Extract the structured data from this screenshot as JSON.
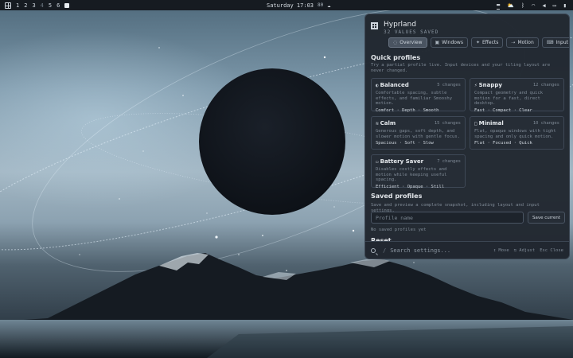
{
  "topbar": {
    "workspaces": [
      "1",
      "2",
      "3",
      "4",
      "5",
      "6"
    ],
    "clock": "Saturday 17:03",
    "clock_extra": "80",
    "tray_icons": [
      "screen-icon",
      "cloud-upload-icon",
      "bluetooth-icon",
      "wifi-icon",
      "volume-icon",
      "monitor-icon",
      "battery-icon"
    ]
  },
  "panel": {
    "title": "Hyprland",
    "subtitle": "32 VALUES SAVED",
    "tabs": [
      {
        "icon": "◌",
        "label": "Overview"
      },
      {
        "icon": "▣",
        "label": "Windows"
      },
      {
        "icon": "✦",
        "label": "Effects"
      },
      {
        "icon": "⇢",
        "label": "Motion"
      },
      {
        "icon": "⌨",
        "label": "Input"
      }
    ],
    "quick_profiles": {
      "title": "Quick profiles",
      "desc": "Try a partial profile live. Input devices and your tiling layout are never changed.",
      "cards": [
        {
          "icon": "◐",
          "name": "Balanced",
          "count": "5 changes",
          "desc": "Comfortable spacing, subtle effects, and familiar Smooshy motion.",
          "tags": "Comfort · Depth · Smooth"
        },
        {
          "icon": "⚡",
          "name": "Snappy",
          "count": "12 changes",
          "desc": "Compact geometry and quick motion for a fast, direct desktop.",
          "tags": "Fast · Compact · Clear"
        },
        {
          "icon": "≋",
          "name": "Calm",
          "count": "15 changes",
          "desc": "Generous gaps, soft depth, and slower motion with gentle focus.",
          "tags": "Spacious · Soft · Slow"
        },
        {
          "icon": "□",
          "name": "Minimal",
          "count": "10 changes",
          "desc": "Flat, opaque windows with tight spacing and only quick motion.",
          "tags": "Flat · Focused · Quick"
        },
        {
          "icon": "▭",
          "name": "Battery Saver",
          "count": "7 changes",
          "desc": "Disables costly effects and motion while keeping useful spacing.",
          "tags": "Efficient · Opaque · Still"
        }
      ]
    },
    "saved_profiles": {
      "title": "Saved profiles",
      "desc": "Save and preview a complete snapshot, including layout and input settings.",
      "input_placeholder": "Profile name",
      "save_label": "Save current",
      "empty": "No saved profiles yet"
    },
    "reset": {
      "title": "Reset"
    },
    "footer": {
      "search_placeholder": "Search settings...",
      "hints": [
        "↕ Move",
        "⇆ Adjust",
        "Esc Close"
      ]
    }
  }
}
